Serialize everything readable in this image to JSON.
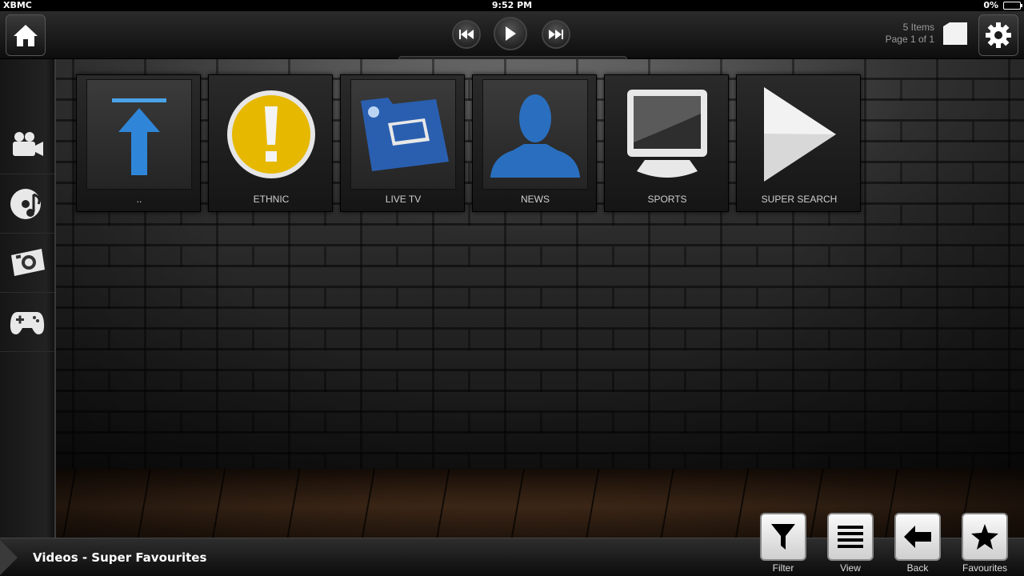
{
  "status_bar": {
    "app_name": "XBMC",
    "time": "9:52 PM",
    "battery": "0%"
  },
  "top_bar": {
    "items_count": "5 Items",
    "page": "Page 1 of 1"
  },
  "sidebar": {
    "items": [
      {
        "name": "videos",
        "icon": "video-camera-icon"
      },
      {
        "name": "music",
        "icon": "music-disc-icon"
      },
      {
        "name": "pictures",
        "icon": "camera-icon"
      },
      {
        "name": "games",
        "icon": "gamepad-icon"
      }
    ]
  },
  "tiles": [
    {
      "label": "..",
      "icon": "up-arrow-icon"
    },
    {
      "label": "ETHNIC",
      "icon": "warning-icon",
      "accent": "#e6b800"
    },
    {
      "label": "LIVE TV",
      "icon": "tv-folder-icon",
      "accent": "#2a5fb0"
    },
    {
      "label": "NEWS",
      "icon": "person-silhouette-icon",
      "accent": "#2a6fbf"
    },
    {
      "label": "SPORTS",
      "icon": "monitor-icon"
    },
    {
      "label": "SUPER SEARCH",
      "icon": "play-triangle-icon"
    }
  ],
  "bottom_bar": {
    "breadcrumb": "Videos - Super Favourites",
    "buttons": [
      {
        "label": "Filter",
        "icon": "filter-icon"
      },
      {
        "label": "View",
        "icon": "list-icon"
      },
      {
        "label": "Back",
        "icon": "back-arrow-icon"
      },
      {
        "label": "Favourites",
        "icon": "star-icon"
      }
    ]
  }
}
